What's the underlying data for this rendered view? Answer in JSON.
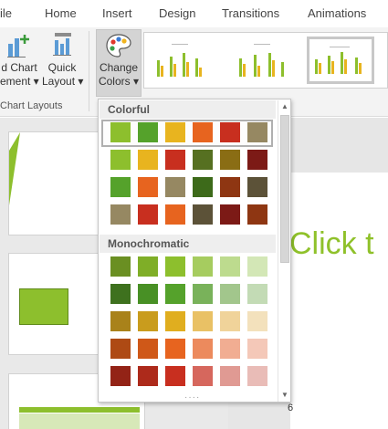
{
  "tabs": [
    "ile",
    "Home",
    "Insert",
    "Design",
    "Transitions",
    "Animations"
  ],
  "ribbon": {
    "add_chart_element": {
      "line1": "d Chart",
      "line2": "ement ▾"
    },
    "quick_layout": {
      "line1": "Quick",
      "line2": "Layout ▾"
    },
    "change_colors": {
      "line1": "Change",
      "line2": "Colors ▾"
    },
    "group_label": "Chart Layouts"
  },
  "dropdown": {
    "colorful_label": "Colorful",
    "colorful_rows": [
      [
        "#8dbf2d",
        "#55a22b",
        "#e8b41f",
        "#e7641f",
        "#c82f1f",
        "#968862"
      ],
      [
        "#8dbf2d",
        "#e8b41f",
        "#c82f1f",
        "#567021",
        "#8a6d14",
        "#7c1a16"
      ],
      [
        "#55a22b",
        "#e7641f",
        "#968862",
        "#3d6a1a",
        "#8e3612",
        "#5c5238"
      ],
      [
        "#968862",
        "#c82f1f",
        "#e7641f",
        "#5c5238",
        "#7c1a16",
        "#8e3612"
      ]
    ],
    "mono_label": "Monochromatic",
    "mono_rows": [
      [
        "#6a8f22",
        "#7fae27",
        "#8dbf2d",
        "#a6cc5f",
        "#bddb8e",
        "#d3e7b6"
      ],
      [
        "#3e711e",
        "#489025",
        "#55a22b",
        "#79b25a",
        "#a2c68c",
        "#c3dbb5"
      ],
      [
        "#a9821a",
        "#c99c1d",
        "#e0ae1f",
        "#e9c165",
        "#f0d39a",
        "#f3e1bc"
      ],
      [
        "#ae4a14",
        "#cf5818",
        "#e7641f",
        "#ec8a5d",
        "#f1ad92",
        "#f4c8b8"
      ],
      [
        "#932316",
        "#ad2a1b",
        "#c82f1f",
        "#d6675d",
        "#e09a93",
        "#e9bcb7"
      ]
    ]
  },
  "slide_main": {
    "title_text": "Click t",
    "slide_number": "6"
  }
}
